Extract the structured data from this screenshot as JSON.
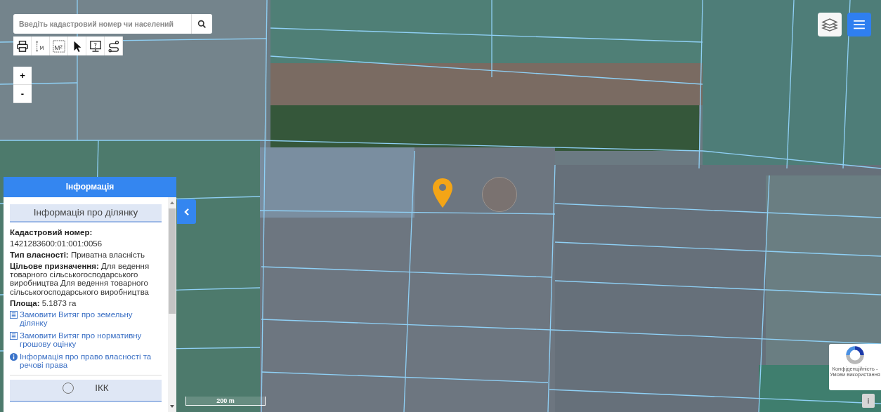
{
  "search": {
    "placeholder": "Введіть кадастровий номер чи населений"
  },
  "tools": [
    {
      "kind": "print"
    },
    {
      "kind": "distance",
      "label": "M"
    },
    {
      "kind": "area",
      "label": "M²"
    },
    {
      "kind": "pointer"
    },
    {
      "kind": "help",
      "label": "?"
    },
    {
      "kind": "route"
    }
  ],
  "zoom": [
    "+",
    "-"
  ],
  "panel": {
    "title": "Інформація",
    "section": "Інформація про ділянку",
    "fields": [
      {
        "kind": "stacked",
        "label": "Кадастровий номер:",
        "value": "1421283600:01:001:0056"
      },
      {
        "kind": "inline",
        "label": "Тип власності:",
        "value": "Приватна власність"
      },
      {
        "kind": "inline",
        "label": "Цільове призначення:",
        "value": "Для ведення товарного сільськогосподарського виробництва Для ведення товарного сільськогосподарського виробництва"
      },
      {
        "kind": "inline",
        "label": "Площа:",
        "value": "5.1873 га"
      }
    ],
    "links": [
      {
        "kind": "document",
        "text": "Замовити Витяг про земельну ділянку"
      },
      {
        "kind": "document",
        "text": "Замовити Витяг про нормативну грошову оцінку"
      },
      {
        "kind": "info",
        "text": "Інформація про право власності та речові права"
      }
    ],
    "next_section": "ІКК"
  },
  "scale": "200 m",
  "recaptcha": "Конфіденційність - Умови використання",
  "info_button": "i"
}
